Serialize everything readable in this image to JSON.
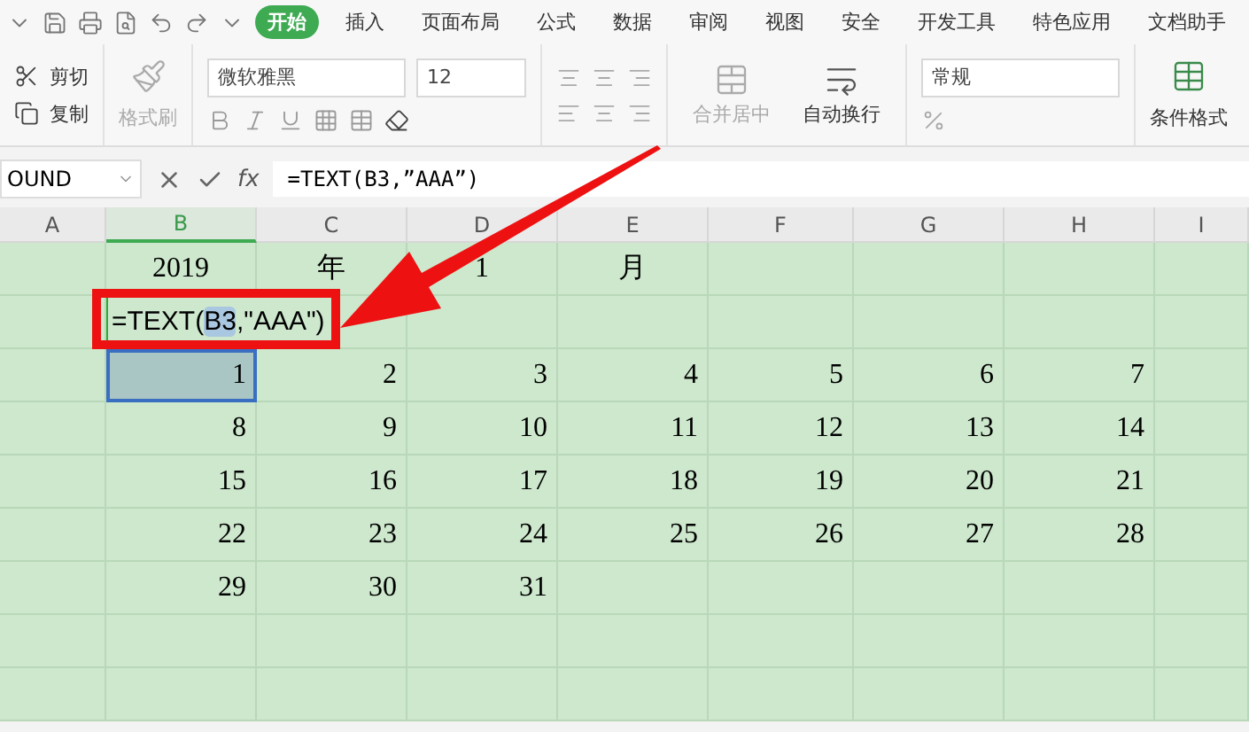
{
  "menu_tabs": [
    {
      "label": "开始",
      "selected": true
    },
    {
      "label": "插入",
      "selected": false
    },
    {
      "label": "页面布局",
      "selected": false
    },
    {
      "label": "公式",
      "selected": false
    },
    {
      "label": "数据",
      "selected": false
    },
    {
      "label": "审阅",
      "selected": false
    },
    {
      "label": "视图",
      "selected": false
    },
    {
      "label": "安全",
      "selected": false
    },
    {
      "label": "开发工具",
      "selected": false
    },
    {
      "label": "特色应用",
      "selected": false
    },
    {
      "label": "文档助手",
      "selected": false
    }
  ],
  "ribbon": {
    "cut": "剪切",
    "copy": "复制",
    "format_painter": "格式刷",
    "font": "微软雅黑",
    "font_size": "12",
    "merge": "合并居中",
    "wrap": "自动换行",
    "number_format": "常规",
    "conditional": "条件格式"
  },
  "formula_bar": {
    "name_box": "OUND",
    "fx": "fx",
    "formula": "=TEXT(B3,”AAA”)"
  },
  "columns": [
    {
      "label": "A",
      "selected": false
    },
    {
      "label": "B",
      "selected": true
    },
    {
      "label": "C",
      "selected": false
    },
    {
      "label": "D",
      "selected": false
    },
    {
      "label": "E",
      "selected": false
    },
    {
      "label": "F",
      "selected": false
    },
    {
      "label": "G",
      "selected": false
    },
    {
      "label": "H",
      "selected": false
    },
    {
      "label": "I",
      "selected": false
    }
  ],
  "rows": [
    {
      "cells": [
        null,
        {
          "kind": "text",
          "text": "2019",
          "selected": false
        },
        {
          "kind": "text",
          "text": "年",
          "selected": false
        },
        {
          "kind": "text",
          "text": "1",
          "selected": false
        },
        {
          "kind": "text",
          "text": "月",
          "selected": false
        },
        null,
        null,
        null,
        null
      ]
    },
    {
      "cells": [
        null,
        {
          "kind": "editor",
          "before": "=TEXT(",
          "ref": "B3",
          "after": ",\"AAA\")",
          "selected": false
        },
        null,
        null,
        null,
        null,
        null,
        null,
        null
      ]
    },
    {
      "cells": [
        null,
        {
          "kind": "number",
          "text": "1",
          "selected": true
        },
        {
          "kind": "number",
          "text": "2",
          "selected": false
        },
        {
          "kind": "number",
          "text": "3",
          "selected": false
        },
        {
          "kind": "number",
          "text": "4",
          "selected": false
        },
        {
          "kind": "number",
          "text": "5",
          "selected": false
        },
        {
          "kind": "number",
          "text": "6",
          "selected": false
        },
        {
          "kind": "number",
          "text": "7",
          "selected": false
        },
        null
      ]
    },
    {
      "cells": [
        null,
        {
          "kind": "number",
          "text": "8",
          "selected": false
        },
        {
          "kind": "number",
          "text": "9",
          "selected": false
        },
        {
          "kind": "number",
          "text": "10",
          "selected": false
        },
        {
          "kind": "number",
          "text": "11",
          "selected": false
        },
        {
          "kind": "number",
          "text": "12",
          "selected": false
        },
        {
          "kind": "number",
          "text": "13",
          "selected": false
        },
        {
          "kind": "number",
          "text": "14",
          "selected": false
        },
        null
      ]
    },
    {
      "cells": [
        null,
        {
          "kind": "number",
          "text": "15",
          "selected": false
        },
        {
          "kind": "number",
          "text": "16",
          "selected": false
        },
        {
          "kind": "number",
          "text": "17",
          "selected": false
        },
        {
          "kind": "number",
          "text": "18",
          "selected": false
        },
        {
          "kind": "number",
          "text": "19",
          "selected": false
        },
        {
          "kind": "number",
          "text": "20",
          "selected": false
        },
        {
          "kind": "number",
          "text": "21",
          "selected": false
        },
        null
      ]
    },
    {
      "cells": [
        null,
        {
          "kind": "number",
          "text": "22",
          "selected": false
        },
        {
          "kind": "number",
          "text": "23",
          "selected": false
        },
        {
          "kind": "number",
          "text": "24",
          "selected": false
        },
        {
          "kind": "number",
          "text": "25",
          "selected": false
        },
        {
          "kind": "number",
          "text": "26",
          "selected": false
        },
        {
          "kind": "number",
          "text": "27",
          "selected": false
        },
        {
          "kind": "number",
          "text": "28",
          "selected": false
        },
        null
      ]
    },
    {
      "cells": [
        null,
        {
          "kind": "number",
          "text": "29",
          "selected": false
        },
        {
          "kind": "number",
          "text": "30",
          "selected": false
        },
        {
          "kind": "number",
          "text": "31",
          "selected": false
        },
        null,
        null,
        null,
        null,
        null
      ]
    },
    {
      "cells": [
        null,
        null,
        null,
        null,
        null,
        null,
        null,
        null,
        null
      ]
    },
    {
      "cells": [
        null,
        null,
        null,
        null,
        null,
        null,
        null,
        null,
        null
      ]
    }
  ]
}
